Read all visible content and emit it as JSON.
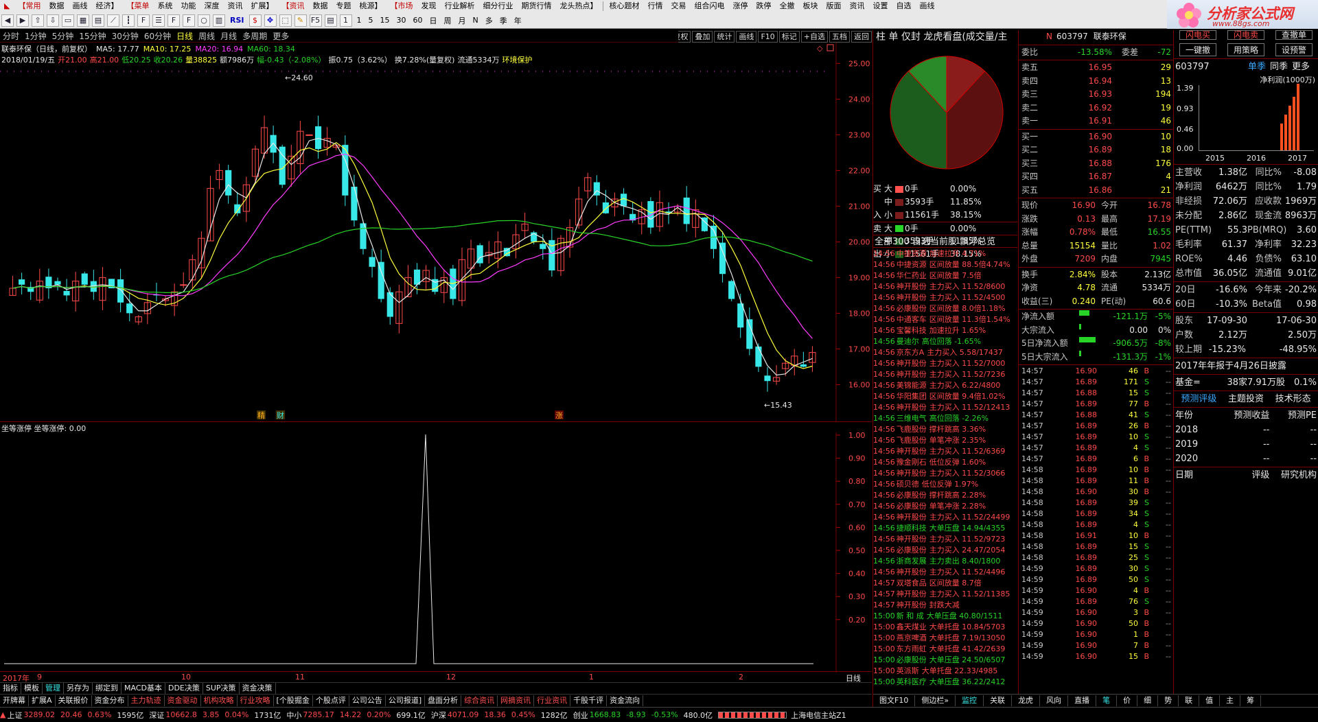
{
  "topmenu": [
    "【常用",
    "数据",
    "画线",
    "经济】",
    "【菜单",
    "系统",
    "功能",
    "深度",
    "资讯",
    "扩展】",
    "【资讯",
    "数据",
    "专题",
    "桃源】",
    "【市场",
    "发现",
    "行业解析",
    "细分行业",
    "期货行情",
    "龙头热点】",
    "核心题材",
    "行情",
    "交易",
    "组合闪电",
    "涨停",
    "跌停",
    "全撤",
    "板块",
    "版面",
    "资讯",
    "设置",
    "自选",
    "画线"
  ],
  "toolbar": {
    "periods": [
      "1",
      "5",
      "15",
      "30",
      "60"
    ],
    "cal": [
      "日",
      "周",
      "月",
      "N",
      "多",
      "季",
      "年"
    ],
    "rsi": "RSI"
  },
  "logo": {
    "name": "分析家公式网",
    "url": "www.88gs.com"
  },
  "periodbar": [
    "分时",
    "1分钟",
    "5分钟",
    "15分钟",
    "30分钟",
    "60分钟",
    "日线",
    "周线",
    "月线",
    "多周期",
    "更多"
  ],
  "periodbar_active": "日线",
  "charttools": [
    "复权",
    "叠加",
    "统计",
    "画线",
    "F10",
    "标记",
    "+自选",
    "五档",
    "返回"
  ],
  "stock": {
    "title": "联泰环保（日线，前复权）",
    "ma5": "MA5: 17.77",
    "ma10": "MA10: 17.25",
    "ma20": "MA20: 16.94",
    "ma60": "MA60: 18.34",
    "date": "2018/01/19/五",
    "open": "开21.00",
    "high": "高21.00",
    "low": "低20.25",
    "close": "收20.26",
    "vol": "量38825",
    "amt": "额7986万",
    "chg": "幅-0.43（-2.08%）",
    "swing": "振0.75（3.62%）",
    "turn": "换7.28%(量复权)",
    "float": "流通5334万",
    "env": "环境保护"
  },
  "chart_data": {
    "type": "candlestick",
    "ylabels": [
      "25.00",
      "24.00",
      "23.00",
      "22.00",
      "21.00",
      "20.00",
      "19.00",
      "18.00",
      "17.00",
      "16.00"
    ],
    "hi_label": "24.60",
    "lo_label": "15.43",
    "ylim": [
      15.2,
      25.2
    ],
    "markers": [
      "精",
      "财",
      "涨"
    ],
    "xlabels": [
      "2017年",
      "9",
      "10",
      "11",
      "12",
      "1",
      "2"
    ],
    "indicator": {
      "title": "坐等涨停 坐等涨停: 0.00",
      "ylabels": [
        "1.00",
        "0.90",
        "0.80",
        "0.70",
        "0.60",
        "0.50",
        "0.40",
        "0.30",
        "0.20"
      ],
      "spike_at": "12"
    }
  },
  "tabs1": [
    "指标",
    "模板",
    "管理",
    "另存为",
    "绑定到",
    "MACD基本",
    "DDE决策",
    "SUP决策",
    "资金决策"
  ],
  "tabs1_right": [
    "日线"
  ],
  "tabs2": [
    "开牌幕",
    "扩展A",
    "关联报价",
    "资金分布",
    "主力轨迹",
    "资金驱动",
    "机构攻略",
    "行业攻略",
    "[个股掘金",
    "个股点评",
    "公司公告",
    "公司报道]",
    "盘面分析",
    "综合资讯",
    "网摘资讯",
    "行业资讯",
    "千股千评",
    "资金流向"
  ],
  "tabs2_red": [
    "主力轨迹",
    "资金驱动",
    "机构攻略",
    "行业攻略",
    "综合资讯",
    "网摘资讯",
    "行业资讯"
  ],
  "bottabs": [
    "图文F10",
    "侧边栏»",
    "监控",
    "关联",
    "龙虎",
    "风向",
    "直播",
    "笔",
    "价",
    "细",
    "势",
    "联",
    "值",
    "主",
    "筹"
  ],
  "status": {
    "sh": "上证",
    "sh_v": "3289.02",
    "sh_c": "20.46",
    "sh_p": "0.63%",
    "sh_a": "1595亿",
    "sz": "深证",
    "sz_v": "10662.8",
    "sz_c": "3.85",
    "sz_p": "0.04%",
    "sz_a": "1731亿",
    "zx": "中小",
    "zx_v": "7285.17",
    "zx_c": "14.22",
    "zx_p": "0.20%",
    "zx_a": "699.1亿",
    "hs": "沪深",
    "hs_v": "4071.09",
    "hs_c": "18.36",
    "hs_p": "0.45%",
    "hs_a": "1282亿",
    "cy": "创业",
    "cy_v": "1668.83",
    "cy_c": "-8.93",
    "cy_p": "-0.53%",
    "cy_a": "480.0亿",
    "server": "上海电信主站Z1"
  },
  "mid": {
    "title": "柱 单 仅封 龙虎看盘(成交量/主",
    "flow": [
      [
        "买",
        "大",
        "0手",
        "0.00%"
      ],
      [
        "",
        "中",
        "3593手",
        "11.85%"
      ],
      [
        "入",
        "小",
        "11561手",
        "38.15%"
      ],
      [
        "卖",
        "大",
        "0手",
        "0.00%"
      ],
      [
        "",
        "中",
        "3593手",
        "11.85%"
      ],
      [
        "出",
        "小",
        "11561手",
        "38.15%"
      ]
    ],
    "filter": "全部300 自选当前股 飘浮总览",
    "ticks": [
      [
        "14:56",
        "中捷资源",
        "加速拉升 4.71%",
        "r"
      ],
      [
        "14:56",
        "中捷资源",
        "区间放量 88.5倍4.74%",
        "r"
      ],
      [
        "14:56",
        "华仁药业",
        "区间放量 7.5倍",
        "r"
      ],
      [
        "14:56",
        "神开股份",
        "主力买入 11.52/8600",
        "r"
      ],
      [
        "14:56",
        "神开股份",
        "主力买入 11.52/4500",
        "r"
      ],
      [
        "14:56",
        "必康股份",
        "区间放量 8.0倍1.18%",
        "r"
      ],
      [
        "14:56",
        "中通客车",
        "区间放量 11.3倍1.54%",
        "r"
      ],
      [
        "14:56",
        "宝馨科技",
        "加速拉升 1.65%",
        "r"
      ],
      [
        "14:56",
        "曼迪尔",
        "高位回落 -1.65%",
        "g"
      ],
      [
        "14:56",
        "京东方A",
        "主力买入 5.58/17437",
        "r"
      ],
      [
        "14:56",
        "神开股份",
        "主力买入 11.52/7000",
        "r"
      ],
      [
        "14:56",
        "神开股份",
        "主力买入 11.52/7236",
        "r"
      ],
      [
        "14:56",
        "美锦能源",
        "主力买入 6.22/4800",
        "r"
      ],
      [
        "14:56",
        "华阳集团",
        "区间放量 9.4倍1.02%",
        "r"
      ],
      [
        "14:56",
        "神开股份",
        "主力买入 11.52/12413",
        "r"
      ],
      [
        "14:56",
        "三维电气",
        "高位回落 -2.26%",
        "g"
      ],
      [
        "14:56",
        "飞鹿股份",
        "撑杆跳高 3.36%",
        "r"
      ],
      [
        "14:56",
        "飞鹿股份",
        "单笔冲涨 2.35%",
        "r"
      ],
      [
        "14:56",
        "神开股份",
        "主力买入 11.52/6369",
        "r"
      ],
      [
        "14:56",
        "豫金刚石",
        "低位反弹 1.60%",
        "r"
      ],
      [
        "14:56",
        "神开股份",
        "主力买入 11.52/3066",
        "r"
      ],
      [
        "14:56",
        "硕贝德",
        "低位反弹 1.97%",
        "r"
      ],
      [
        "14:56",
        "必康股份",
        "撑杆跳高 2.28%",
        "r"
      ],
      [
        "14:56",
        "必康股份",
        "单笔冲涨 2.28%",
        "r"
      ],
      [
        "14:56",
        "神开股份",
        "主力买入 11.52/24499",
        "r"
      ],
      [
        "14:56",
        "捷顺科技",
        "大单压盘 14.94/4355",
        "g"
      ],
      [
        "14:56",
        "神开股份",
        "主力买入 11.52/9723",
        "r"
      ],
      [
        "14:56",
        "必康股份",
        "主力买入 24.47/2054",
        "r"
      ],
      [
        "14:56",
        "浙商发展",
        "主力卖出 8.40/1800",
        "g"
      ],
      [
        "14:56",
        "神开股份",
        "主力买入 11.52/4496",
        "r"
      ],
      [
        "14:57",
        "双塔食品",
        "区间放量 8.7倍",
        "r"
      ],
      [
        "14:57",
        "神开股份",
        "主力买入 11.52/11385",
        "r"
      ],
      [
        "14:57",
        "神开股份",
        "封跌大减",
        "r"
      ],
      [
        "15:00",
        "新 和 成",
        "大单压盘 40.80/1511",
        "g"
      ],
      [
        "15:00",
        "鑫天煤业",
        "大单托盘 10.84/5703",
        "r"
      ],
      [
        "15:00",
        "燕京啤酒",
        "大单托盘 7.19/13050",
        "r"
      ],
      [
        "15:00",
        "东方雨虹",
        "大单托盘 41.42/2639",
        "r"
      ],
      [
        "15:00",
        "必康股份",
        "大单压盘 24.50/6507",
        "g"
      ],
      [
        "15:00",
        "英派斯",
        "大单托盘 22.33/4985",
        "r"
      ],
      [
        "15:00",
        "英科医疗",
        "大单压盘 36.22/2412",
        "g"
      ]
    ]
  },
  "quote": {
    "code": "603797",
    "name": "联泰环保",
    "wb": "委比",
    "wb_v": "-13.58%",
    "wc": "委差",
    "wc_v": "-72",
    "asks": [
      [
        "卖五",
        "16.95",
        "29"
      ],
      [
        "卖四",
        "16.94",
        "13"
      ],
      [
        "卖三",
        "16.93",
        "194"
      ],
      [
        "卖二",
        "16.92",
        "19"
      ],
      [
        "卖一",
        "16.91",
        "46"
      ]
    ],
    "bids": [
      [
        "买一",
        "16.90",
        "10"
      ],
      [
        "买二",
        "16.89",
        "18"
      ],
      [
        "买三",
        "16.88",
        "176"
      ],
      [
        "买四",
        "16.87",
        "4"
      ],
      [
        "买五",
        "16.86",
        "21"
      ]
    ],
    "stats": [
      [
        "现价",
        "16.90",
        "今开",
        "16.78"
      ],
      [
        "涨跌",
        "0.13",
        "最高",
        "17.19"
      ],
      [
        "涨幅",
        "0.78%",
        "最低",
        "16.55"
      ],
      [
        "总量",
        "15154",
        "量比",
        "1.02"
      ],
      [
        "外盘",
        "7209",
        "内盘",
        "7945"
      ]
    ],
    "stats2": [
      [
        "换手",
        "2.84%",
        "股本",
        "2.13亿"
      ],
      [
        "净资",
        "4.78",
        "流通",
        "5334万"
      ],
      [
        "收益(三)",
        "0.240",
        "PE(动)",
        "60.6"
      ]
    ],
    "flows": [
      [
        "净流入额",
        "-121.1万",
        "-5%"
      ],
      [
        "大宗流入",
        "0.00",
        "0%"
      ],
      [
        "5日净流入额",
        "-906.5万",
        "-8%"
      ],
      [
        "5日大宗流入",
        "-131.3万",
        "-1%"
      ]
    ],
    "trades": [
      [
        "14:57",
        "16.90",
        "46",
        "B"
      ],
      [
        "14:57",
        "16.89",
        "171",
        "S"
      ],
      [
        "14:57",
        "16.88",
        "15",
        "S"
      ],
      [
        "14:57",
        "16.89",
        "77",
        "B"
      ],
      [
        "14:57",
        "16.88",
        "41",
        "S"
      ],
      [
        "14:57",
        "16.89",
        "26",
        "B"
      ],
      [
        "14:57",
        "16.89",
        "10",
        "S"
      ],
      [
        "14:57",
        "16.89",
        "4",
        "S"
      ],
      [
        "14:57",
        "16.89",
        "6",
        "B"
      ],
      [
        "14:58",
        "16.89",
        "10",
        "B"
      ],
      [
        "14:58",
        "16.89",
        "11",
        "B"
      ],
      [
        "14:58",
        "16.90",
        "30",
        "B"
      ],
      [
        "14:58",
        "16.89",
        "39",
        "S"
      ],
      [
        "14:58",
        "16.89",
        "34",
        "S"
      ],
      [
        "14:58",
        "16.89",
        "4",
        "S"
      ],
      [
        "14:58",
        "16.91",
        "10",
        "B"
      ],
      [
        "14:58",
        "16.89",
        "15",
        "S"
      ],
      [
        "14:58",
        "16.89",
        "25",
        "S"
      ],
      [
        "14:59",
        "16.89",
        "30",
        "S"
      ],
      [
        "14:59",
        "16.89",
        "50",
        "S"
      ],
      [
        "14:59",
        "16.90",
        "4",
        "B"
      ],
      [
        "14:59",
        "16.89",
        "76",
        "S"
      ],
      [
        "14:59",
        "16.90",
        "3",
        "B"
      ],
      [
        "14:59",
        "16.90",
        "50",
        "B"
      ],
      [
        "14:59",
        "16.90",
        "1",
        "B"
      ],
      [
        "14:59",
        "16.90",
        "7",
        "B"
      ],
      [
        "14:59",
        "16.90",
        "15",
        "B"
      ]
    ]
  },
  "f10": {
    "btns": [
      "一键撤",
      "用策略",
      "设预警"
    ],
    "btn_top": [
      "闪电买",
      "闪电卖",
      "查撤单"
    ],
    "code": "603797",
    "tabs": [
      "单季",
      "同季",
      "更多"
    ],
    "unit": "净利润(1000万)",
    "yticks": [
      "1.39",
      "0.93",
      "0.46",
      "0.00"
    ],
    "years": [
      "2015",
      "2016",
      "2017"
    ],
    "bars": [
      0.6,
      0.8,
      1.0,
      1.2,
      1.5
    ],
    "fin": [
      [
        "主营收",
        "1.38亿",
        "同比%",
        "-8.08"
      ],
      [
        "净利润",
        "6462万",
        "同比%",
        "1.79"
      ],
      [
        "非经损",
        "72.06万",
        "应收款",
        "1969万"
      ],
      [
        "未分配",
        "2.86亿",
        "现金流",
        "8963万"
      ],
      [
        "PE(TTM)",
        "55.3",
        "PB(MRQ)",
        "3.60"
      ],
      [
        "毛利率",
        "61.37",
        "净利率",
        "32.23"
      ],
      [
        "ROE%",
        "4.46",
        "负债%",
        "63.10"
      ],
      [
        "总市值",
        "36.05亿",
        "流通值",
        "9.01亿"
      ]
    ],
    "perf": [
      [
        "20日",
        "-16.6%",
        "今年来",
        "-20.2%"
      ],
      [
        "60日",
        "-10.3%",
        "Beta值",
        "0.98"
      ]
    ],
    "shares": [
      [
        "股东",
        "17-09-30",
        "",
        "17-06-30"
      ],
      [
        "户数",
        "2.12万",
        "",
        "2.50万"
      ],
      [
        "较上期",
        "-15.23%",
        "",
        "-48.95%"
      ]
    ],
    "notice": "2017年年报于4月26日披露",
    "fund": [
      "基金=",
      "38家",
      "7.91万股",
      "0.1%"
    ],
    "tabs2": [
      "预测评级",
      "主题投资",
      "技术形态"
    ],
    "fc_head": [
      "年份",
      "预测收益",
      "预测PE"
    ],
    "fc": [
      [
        "2018",
        "--",
        "--"
      ],
      [
        "2019",
        "--",
        "--"
      ],
      [
        "2020",
        "--",
        "--"
      ]
    ],
    "rt_head": [
      "日期",
      "评级",
      "研究机构"
    ]
  },
  "colors": {
    "up": "#ff4a4a",
    "down": "#38e8e8",
    "ma5": "#e8e8e8",
    "ma10": "#ffff3c",
    "ma20": "#ff3cff",
    "ma60": "#28d428"
  }
}
